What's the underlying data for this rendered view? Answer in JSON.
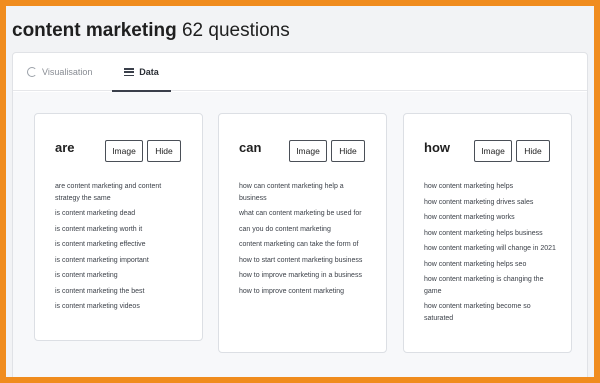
{
  "title": {
    "keyword": "content marketing",
    "count_text": "62 questions"
  },
  "tabs": [
    {
      "label": "Visualisation",
      "active": false,
      "icon": "loading-ring-icon"
    },
    {
      "label": "Data",
      "active": true,
      "icon": "list-icon"
    }
  ],
  "buttons": {
    "image_label": "Image",
    "hide_label": "Hide"
  },
  "columns": [
    {
      "heading": "are",
      "questions": [
        "are content marketing and content strategy the same",
        "is content marketing dead",
        "is content marketing worth it",
        "is content marketing effective",
        "is content marketing important",
        "is content marketing",
        "is content marketing the best",
        "is content marketing videos"
      ]
    },
    {
      "heading": "can",
      "questions": [
        "how can content marketing help a business",
        "what can content marketing be used for",
        "can you do content marketing",
        "content marketing can take the form of",
        "how to start content marketing business",
        "how to improve marketing in a business",
        "how to improve content marketing"
      ]
    },
    {
      "heading": "how",
      "questions": [
        "how content marketing helps",
        "how content marketing drives sales",
        "how content marketing works",
        "how content marketing helps business",
        "how content marketing will change in 2021",
        "how content marketing helps seo",
        "how content marketing is changing the game",
        "how content marketing become so saturated"
      ]
    }
  ],
  "colors": {
    "border_accent": "#f08c1e",
    "active_tab_underline": "#3a3f4a"
  }
}
